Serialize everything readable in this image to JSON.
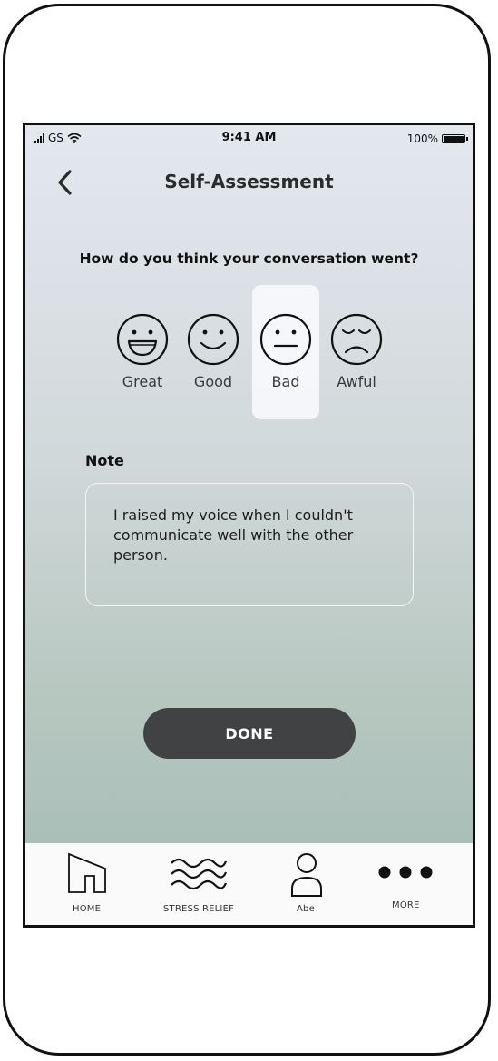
{
  "status_bar": {
    "carrier": "GS",
    "time": "9:41 AM",
    "battery": "100%"
  },
  "header": {
    "title": "Self-Assessment"
  },
  "question": "How do you think your conversation went?",
  "ratings": [
    {
      "label": "Great",
      "icon": "laughing-face-icon",
      "selected": false
    },
    {
      "label": "Good",
      "icon": "smiling-face-icon",
      "selected": false
    },
    {
      "label": "Bad",
      "icon": "neutral-face-icon",
      "selected": true
    },
    {
      "label": "Awful",
      "icon": "sad-face-icon",
      "selected": false
    }
  ],
  "note": {
    "label": "Note",
    "value": "I raised my voice when I couldn't communicate well with the other person."
  },
  "done_button": "DONE",
  "tab_bar": [
    {
      "label": "HOME",
      "icon": "home-icon"
    },
    {
      "label": "STRESS RELIEF",
      "icon": "waves-icon"
    },
    {
      "label": "Abe",
      "icon": "person-icon"
    },
    {
      "label": "MORE",
      "icon": "more-dots-icon"
    }
  ],
  "colors": {
    "button": "#414244",
    "gradient_top": "#e3e8ef",
    "gradient_bottom": "#a3bab4",
    "tab_bar_bg": "#fafafa"
  }
}
